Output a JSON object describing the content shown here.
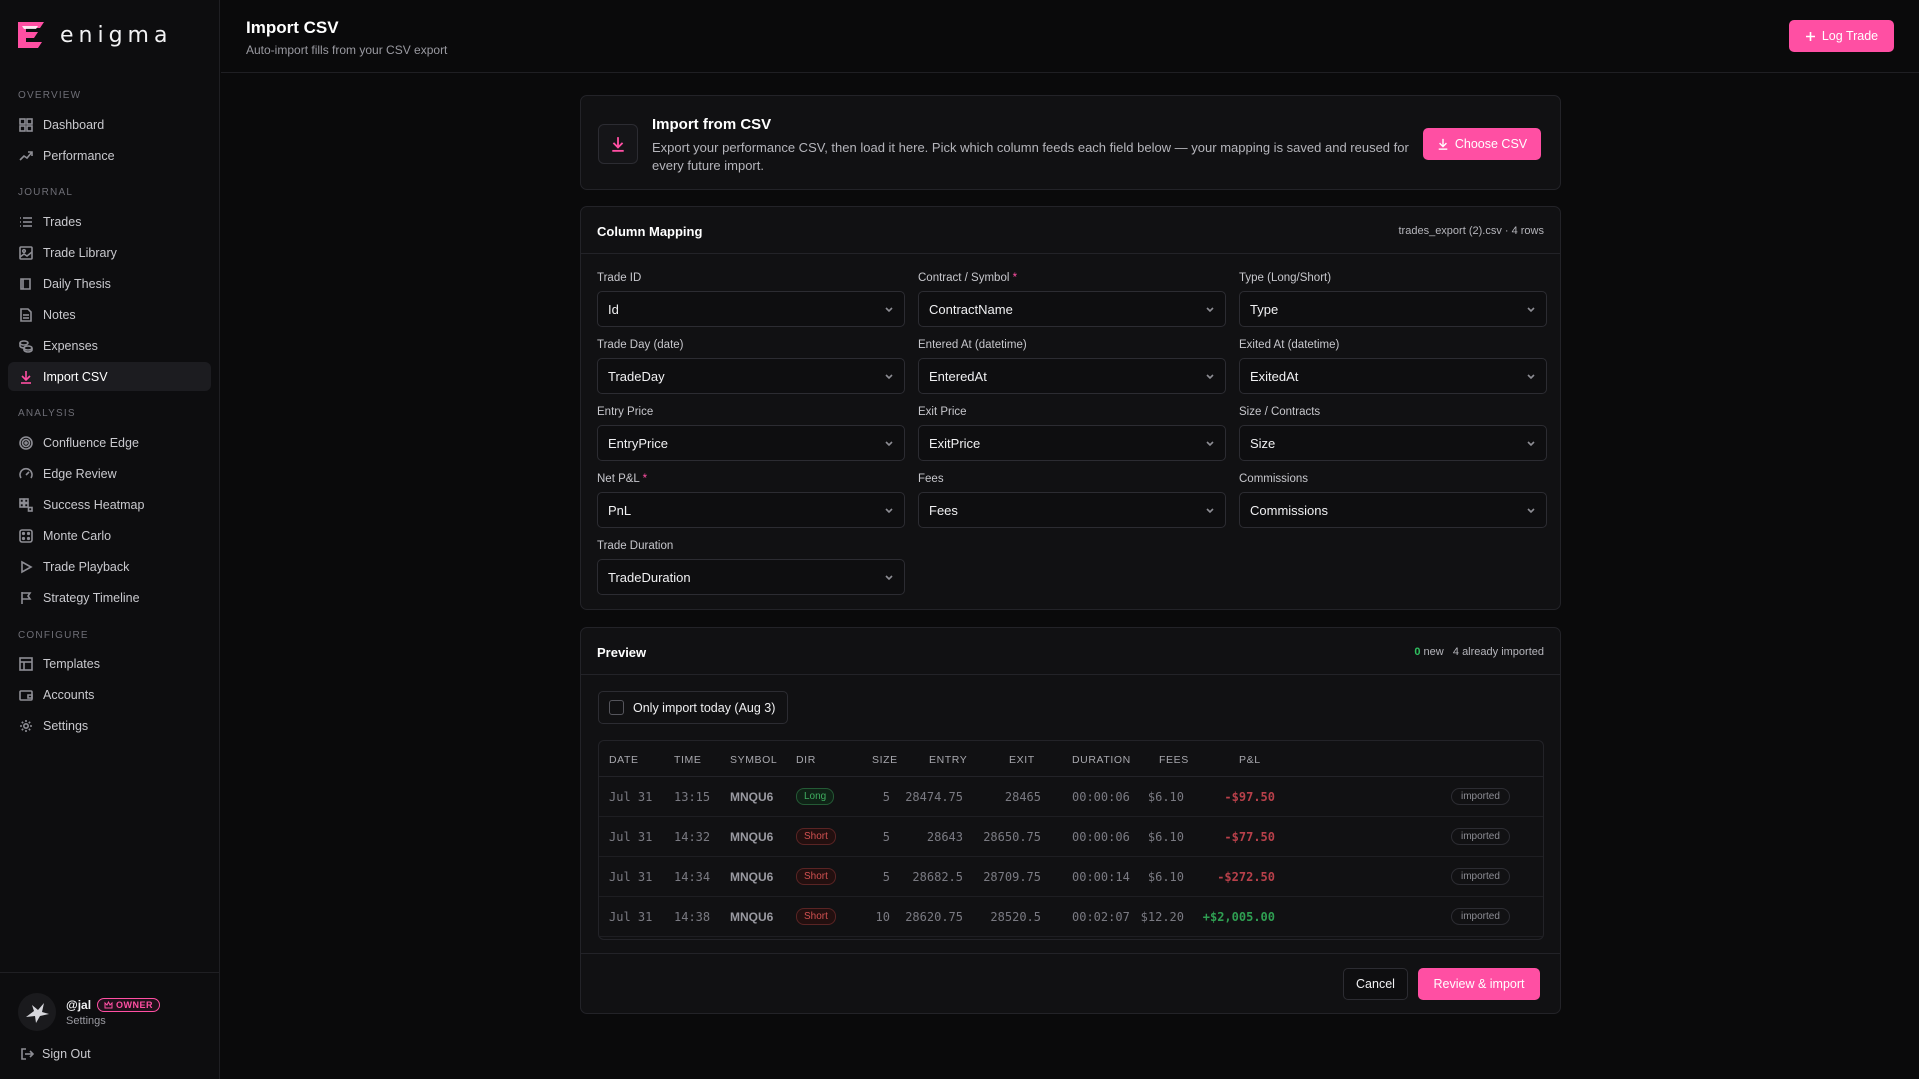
{
  "app": {
    "name": "enigma",
    "accent": "#ff4fa3"
  },
  "sidebar": {
    "sections": [
      {
        "label": "OVERVIEW",
        "items": [
          {
            "label": "Dashboard",
            "icon": "grid-icon"
          },
          {
            "label": "Performance",
            "icon": "trend-icon"
          }
        ]
      },
      {
        "label": "JOURNAL",
        "items": [
          {
            "label": "Trades",
            "icon": "list-icon"
          },
          {
            "label": "Trade Library",
            "icon": "image-icon"
          },
          {
            "label": "Daily Thesis",
            "icon": "book-icon"
          },
          {
            "label": "Notes",
            "icon": "note-icon"
          },
          {
            "label": "Expenses",
            "icon": "coins-icon"
          },
          {
            "label": "Import CSV",
            "icon": "download-icon",
            "active": true
          }
        ]
      },
      {
        "label": "ANALYSIS",
        "items": [
          {
            "label": "Confluence Edge",
            "icon": "target-icon"
          },
          {
            "label": "Edge Review",
            "icon": "gauge-icon"
          },
          {
            "label": "Success Heatmap",
            "icon": "heatmap-icon"
          },
          {
            "label": "Monte Carlo",
            "icon": "dice-icon"
          },
          {
            "label": "Trade Playback",
            "icon": "play-icon"
          },
          {
            "label": "Strategy Timeline",
            "icon": "flag-icon"
          }
        ]
      },
      {
        "label": "CONFIGURE",
        "items": [
          {
            "label": "Templates",
            "icon": "template-icon"
          },
          {
            "label": "Accounts",
            "icon": "wallet-icon"
          },
          {
            "label": "Settings",
            "icon": "gear-icon"
          }
        ]
      }
    ],
    "user": {
      "handle": "@jal",
      "badge": "OWNER",
      "sub": "Settings"
    },
    "signout": "Sign Out"
  },
  "header": {
    "title": "Import CSV",
    "subtitle": "Auto-import fills from your CSV export",
    "log_trade": "Log Trade"
  },
  "import_card": {
    "title": "Import from CSV",
    "description": "Export your performance CSV, then load it here. Pick which column feeds each field below — your mapping is saved and reused for every future import.",
    "button": "Choose CSV"
  },
  "mapping": {
    "title": "Column Mapping",
    "meta": "trades_export (2).csv · 4 rows",
    "fields": [
      {
        "label": "Trade ID",
        "value": "Id",
        "required": false
      },
      {
        "label": "Contract / Symbol",
        "value": "ContractName",
        "required": true
      },
      {
        "label": "Type (Long/Short)",
        "value": "Type",
        "required": false
      },
      {
        "label": "Trade Day (date)",
        "value": "TradeDay",
        "required": false
      },
      {
        "label": "Entered At (datetime)",
        "value": "EnteredAt",
        "required": false
      },
      {
        "label": "Exited At (datetime)",
        "value": "ExitedAt",
        "required": false
      },
      {
        "label": "Entry Price",
        "value": "EntryPrice",
        "required": false
      },
      {
        "label": "Exit Price",
        "value": "ExitPrice",
        "required": false
      },
      {
        "label": "Size / Contracts",
        "value": "Size",
        "required": false
      },
      {
        "label": "Net P&L",
        "value": "PnL",
        "required": true
      },
      {
        "label": "Fees",
        "value": "Fees",
        "required": false
      },
      {
        "label": "Commissions",
        "value": "Commissions",
        "required": false
      },
      {
        "label": "Trade Duration",
        "value": "TradeDuration",
        "required": false
      }
    ]
  },
  "preview": {
    "title": "Preview",
    "new_count": "0",
    "new_label": "new",
    "imported_label": "4 already imported",
    "only_today": "Only import today (Aug 3)",
    "columns": [
      "DATE",
      "TIME",
      "SYMBOL",
      "DIR",
      "SIZE",
      "ENTRY",
      "EXIT",
      "DURATION",
      "FEES",
      "P&L"
    ],
    "rows": [
      {
        "date": "Jul 31",
        "time": "13:15",
        "symbol": "MNQU6",
        "dir": "Long",
        "size": "5",
        "entry": "28474.75",
        "exit": "28465",
        "duration": "00:00:06",
        "fees": "$6.10",
        "pnl": "-$97.50",
        "status": "imported"
      },
      {
        "date": "Jul 31",
        "time": "14:32",
        "symbol": "MNQU6",
        "dir": "Short",
        "size": "5",
        "entry": "28643",
        "exit": "28650.75",
        "duration": "00:00:06",
        "fees": "$6.10",
        "pnl": "-$77.50",
        "status": "imported"
      },
      {
        "date": "Jul 31",
        "time": "14:34",
        "symbol": "MNQU6",
        "dir": "Short",
        "size": "5",
        "entry": "28682.5",
        "exit": "28709.75",
        "duration": "00:00:14",
        "fees": "$6.10",
        "pnl": "-$272.50",
        "status": "imported"
      },
      {
        "date": "Jul 31",
        "time": "14:38",
        "symbol": "MNQU6",
        "dir": "Short",
        "size": "10",
        "entry": "28620.75",
        "exit": "28520.5",
        "duration": "00:02:07",
        "fees": "$12.20",
        "pnl": "+$2,005.00",
        "status": "imported"
      }
    ],
    "cancel": "Cancel",
    "review": "Review & import"
  }
}
